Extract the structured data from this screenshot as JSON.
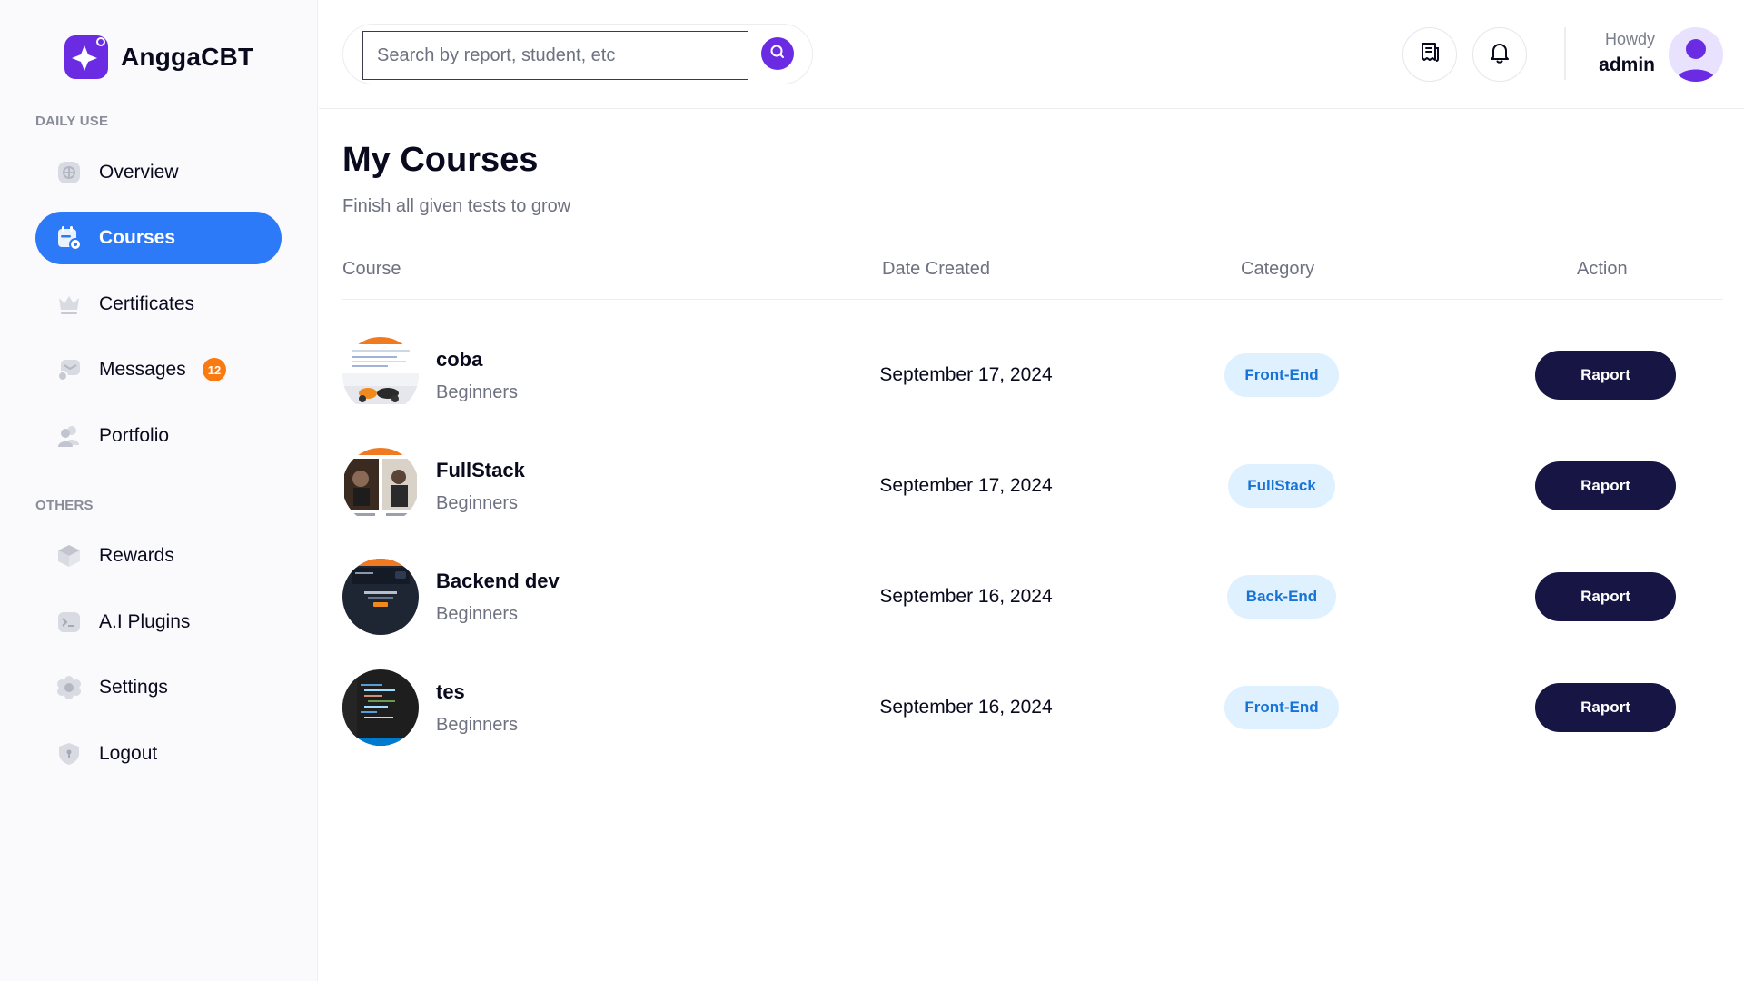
{
  "brand": {
    "name": "AnggaCBT",
    "color": "#6a2be2"
  },
  "sidebar": {
    "sections": [
      {
        "label": "DAILY USE"
      },
      {
        "label": "OTHERS"
      }
    ],
    "items": [
      {
        "label": "Overview",
        "icon": "overview-icon"
      },
      {
        "label": "Courses",
        "icon": "calendar-icon",
        "active": true
      },
      {
        "label": "Certificates",
        "icon": "crown-icon"
      },
      {
        "label": "Messages",
        "icon": "message-icon",
        "badge": "12"
      },
      {
        "label": "Portfolio",
        "icon": "users-icon"
      },
      {
        "label": "Rewards",
        "icon": "box-icon"
      },
      {
        "label": "A.I Plugins",
        "icon": "terminal-icon"
      },
      {
        "label": "Settings",
        "icon": "gear-icon"
      },
      {
        "label": "Logout",
        "icon": "shield-icon"
      }
    ],
    "active_color": "#2d7af8",
    "badge_color": "#fa7a12"
  },
  "search": {
    "placeholder": "Search by report, student, etc",
    "value": ""
  },
  "user": {
    "greeting": "Howdy",
    "name": "admin"
  },
  "main": {
    "title": "My Courses",
    "subtitle": "Finish all given tests to grow",
    "columns": [
      "Course",
      "Date Created",
      "Category",
      "Action"
    ],
    "courses": [
      {
        "name": "coba",
        "level": "Beginners",
        "date": "September 17, 2024",
        "category": "Front-End",
        "action": "Raport"
      },
      {
        "name": "FullStack",
        "level": "Beginners",
        "date": "September 17, 2024",
        "category": "FullStack",
        "action": "Raport"
      },
      {
        "name": "Backend dev",
        "level": "Beginners",
        "date": "September 16, 2024",
        "category": "Back-End",
        "action": "Raport"
      },
      {
        "name": "tes",
        "level": "Beginners",
        "date": "September 16, 2024",
        "category": "Front-End",
        "action": "Raport"
      }
    ]
  },
  "colors": {
    "action_button": "#161544",
    "chip_bg": "#dff0fe",
    "chip_text": "#1773d6"
  }
}
